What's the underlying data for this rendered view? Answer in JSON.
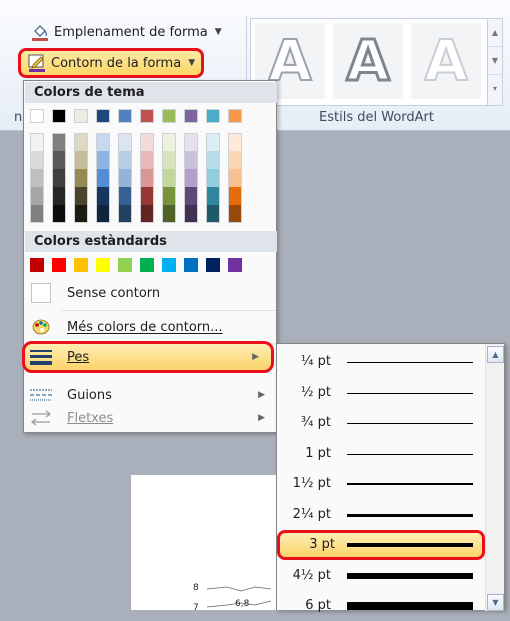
{
  "ribbon": {
    "fill_label": "Emplenament de forma",
    "outline_label": "Contorn de la forma",
    "wordart_group_label": "Estils del WordArt",
    "wordart_glyph": "A",
    "partial_group_letter": "n"
  },
  "menu": {
    "theme_colors_header": "Colors de tema",
    "standard_colors_header": "Colors estàndards",
    "theme_colors": [
      "#ffffff",
      "#000000",
      "#eeece1",
      "#1f497d",
      "#4f81bd",
      "#c0504d",
      "#9bbb59",
      "#8064a2",
      "#4bacc6",
      "#f79646"
    ],
    "theme_shades": [
      [
        "#f2f2f2",
        "#d9d9d9",
        "#bfbfbf",
        "#a6a6a6",
        "#808080"
      ],
      [
        "#7f7f7f",
        "#595959",
        "#404040",
        "#262626",
        "#0d0d0d"
      ],
      [
        "#ddd9c3",
        "#c4bd97",
        "#948a54",
        "#4a452a",
        "#1d1b10"
      ],
      [
        "#c6d9f1",
        "#8eb4e3",
        "#548dd4",
        "#17365d",
        "#0f243e"
      ],
      [
        "#dbe5f1",
        "#b8cce4",
        "#95b3d7",
        "#366092",
        "#244061"
      ],
      [
        "#f2dcdb",
        "#e6b9b8",
        "#d99694",
        "#953735",
        "#632523"
      ],
      [
        "#ebf1de",
        "#d7e4bd",
        "#c3d69b",
        "#77933c",
        "#4f6228"
      ],
      [
        "#e5e0ec",
        "#ccc1da",
        "#b3a2c7",
        "#60497a",
        "#403152"
      ],
      [
        "#dbeef4",
        "#b7dee8",
        "#93cddd",
        "#31859c",
        "#215968"
      ],
      [
        "#fdeada",
        "#fcd5b5",
        "#fac090",
        "#e46c0a",
        "#984807"
      ]
    ],
    "standard_colors": [
      "#c00000",
      "#ff0000",
      "#ffc000",
      "#ffff00",
      "#92d050",
      "#00b050",
      "#00b0f0",
      "#0070c0",
      "#002060",
      "#7030a0"
    ],
    "no_outline_label": "Sense contorn",
    "more_colors_label": "Més colors de contorn...",
    "weight_label": "Pes",
    "dashes_label": "Guions",
    "arrows_label": "Fletxes"
  },
  "weight_submenu": {
    "items": [
      {
        "label": "¼ pt",
        "thickness_pt": 0.25
      },
      {
        "label": "½ pt",
        "thickness_pt": 0.5
      },
      {
        "label": "¾ pt",
        "thickness_pt": 0.75
      },
      {
        "label": "1 pt",
        "thickness_pt": 1
      },
      {
        "label": "1½ pt",
        "thickness_pt": 1.5
      },
      {
        "label": "2¼ pt",
        "thickness_pt": 2.25
      },
      {
        "label": "3 pt",
        "thickness_pt": 3,
        "selected": true
      },
      {
        "label": "4½ pt",
        "thickness_pt": 4.5
      },
      {
        "label": "6 pt",
        "thickness_pt": 6
      }
    ]
  },
  "document": {
    "labels": [
      "8",
      "7",
      "6,8"
    ]
  },
  "colors": {
    "highlight_border": "#e8101a",
    "hover_fill": "#fbd36a"
  }
}
